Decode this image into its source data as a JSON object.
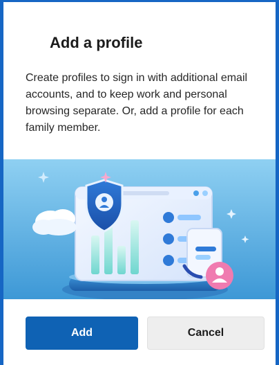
{
  "dialog": {
    "title": "Add a profile",
    "description": "Create profiles to sign in with additional email accounts, and to keep work and personal browsing separate. Or, add a profile for each family member."
  },
  "actions": {
    "add_label": "Add",
    "cancel_label": "Cancel"
  },
  "illustration": {
    "icons": [
      "shield-icon",
      "user-icon",
      "cloud-icon",
      "phone-icon",
      "sparkle-icon"
    ]
  },
  "colors": {
    "accent": "#0f62b4",
    "frame_border": "#1666c4",
    "illustration_bg": "#5fb6e6"
  }
}
